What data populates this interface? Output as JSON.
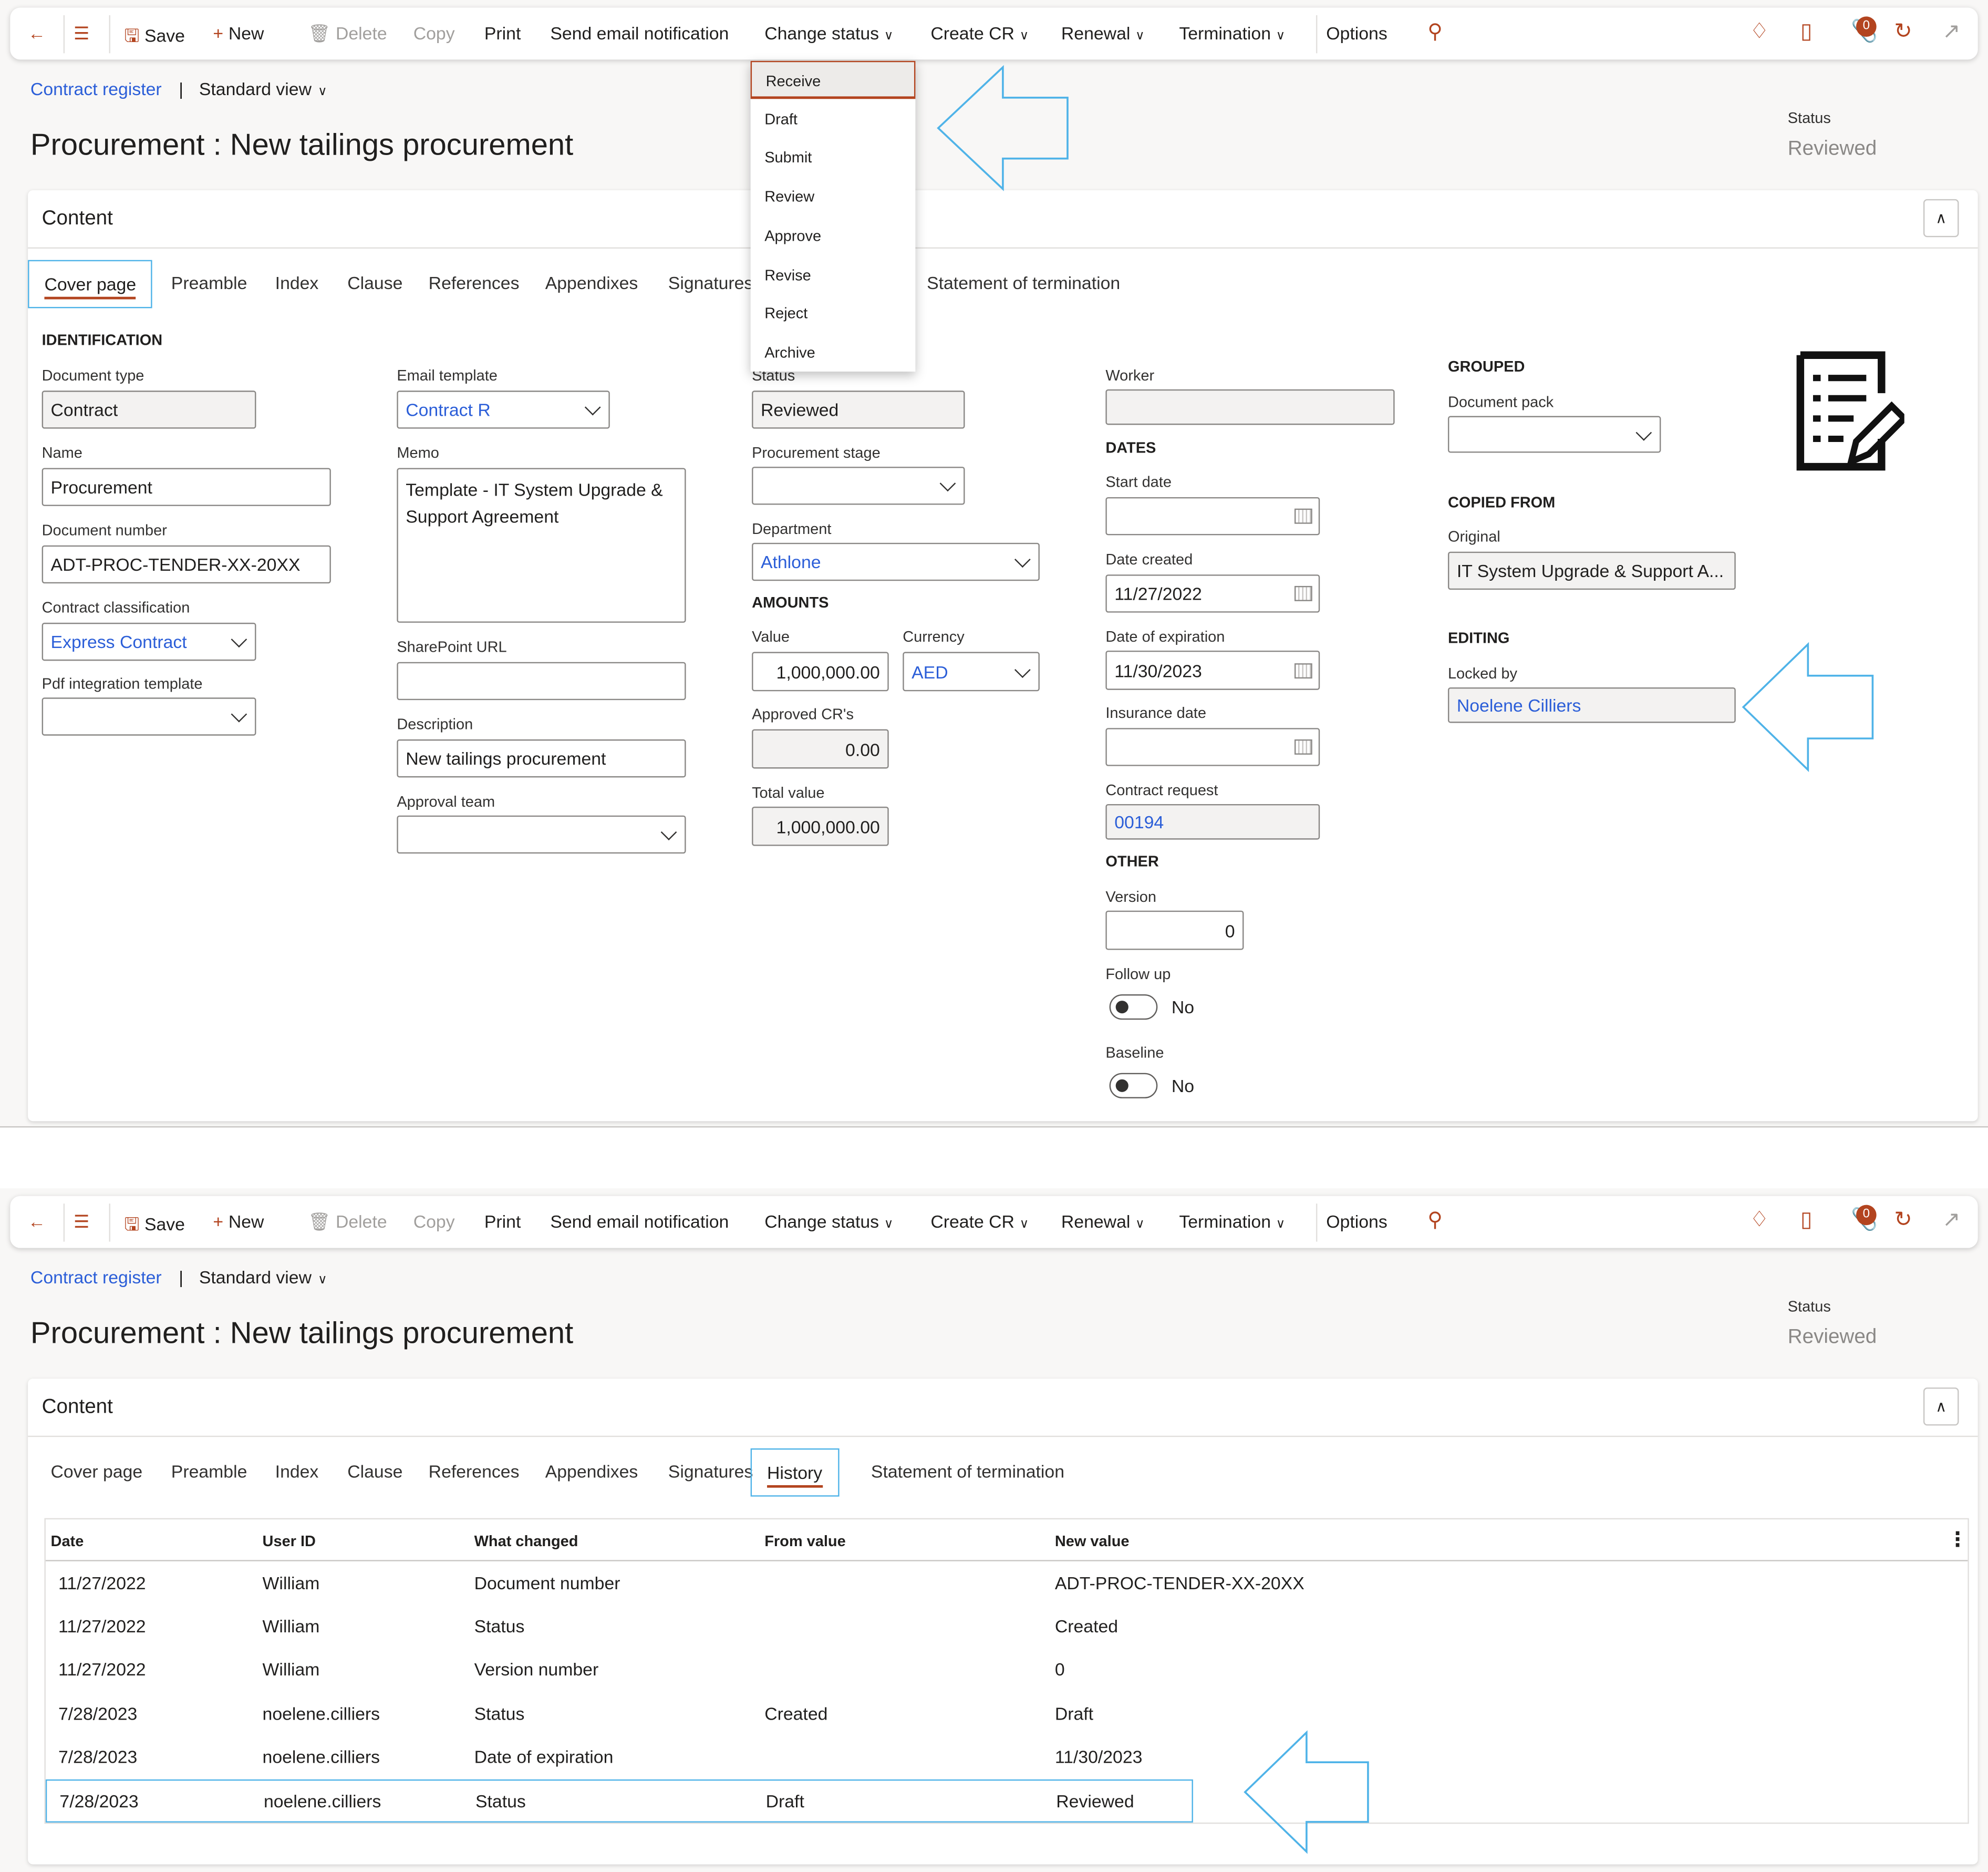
{
  "toolbar": {
    "save": "Save",
    "new": "New",
    "delete": "Delete",
    "copy": "Copy",
    "print": "Print",
    "send_email": "Send email notification",
    "change_status": "Change status",
    "create_cr": "Create CR",
    "renewal": "Renewal",
    "termination": "Termination",
    "options": "Options",
    "attachments_count": "0",
    "icons": [
      "back-arrow-icon",
      "hamburger-icon",
      "save-icon",
      "plus-icon",
      "trash-icon",
      "search-icon",
      "diamond-icon",
      "office-icon",
      "paperclip-icon",
      "refresh-icon",
      "popout-icon"
    ]
  },
  "breadcrumb": {
    "link": "Contract register",
    "separator": "|",
    "view": "Standard view"
  },
  "header": {
    "title": "Procurement : New tailings procurement",
    "status_label": "Status",
    "status_value": "Reviewed"
  },
  "content": {
    "title": "Content"
  },
  "tabs": [
    "Cover page",
    "Preamble",
    "Index",
    "Clause",
    "References",
    "Appendixes",
    "Signatures",
    "History",
    "Statement of termination"
  ],
  "status_menu": [
    "Receive",
    "Draft",
    "Submit",
    "Review",
    "Approve",
    "Revise",
    "Reject",
    "Archive"
  ],
  "cover": {
    "sections": {
      "identification": "IDENTIFICATION",
      "amounts": "AMOUNTS",
      "dates": "DATES",
      "other": "OTHER",
      "grouped": "GROUPED",
      "copied_from": "COPIED FROM",
      "editing": "EDITING"
    },
    "fields": {
      "document_type": {
        "label": "Document type",
        "value": "Contract"
      },
      "name": {
        "label": "Name",
        "value": "Procurement"
      },
      "document_number": {
        "label": "Document number",
        "value": "ADT-PROC-TENDER-XX-20XX"
      },
      "contract_classification": {
        "label": "Contract classification",
        "value": "Express Contract"
      },
      "pdf_template": {
        "label": "Pdf integration template",
        "value": ""
      },
      "email_template": {
        "label": "Email template",
        "value": "Contract R"
      },
      "memo": {
        "label": "Memo",
        "value": "Template - IT System Upgrade & Support Agreement"
      },
      "sharepoint_url": {
        "label": "SharePoint URL",
        "value": ""
      },
      "description": {
        "label": "Description",
        "value": "New tailings procurement"
      },
      "approval_team": {
        "label": "Approval team",
        "value": ""
      },
      "status": {
        "label": "Status",
        "value": "Reviewed"
      },
      "procurement_stage": {
        "label": "Procurement stage",
        "value": ""
      },
      "department": {
        "label": "Department",
        "value": "Athlone"
      },
      "value": {
        "label": "Value",
        "value": "1,000,000.00"
      },
      "currency": {
        "label": "Currency",
        "value": "AED"
      },
      "approved_crs": {
        "label": "Approved CR's",
        "value": "0.00"
      },
      "total_value": {
        "label": "Total value",
        "value": "1,000,000.00"
      },
      "worker": {
        "label": "Worker",
        "value": ""
      },
      "start_date": {
        "label": "Start date",
        "value": ""
      },
      "date_created": {
        "label": "Date created",
        "value": "11/27/2022"
      },
      "date_expiration": {
        "label": "Date of expiration",
        "value": "11/30/2023"
      },
      "insurance_date": {
        "label": "Insurance date",
        "value": ""
      },
      "contract_request": {
        "label": "Contract request",
        "value": "00194"
      },
      "version": {
        "label": "Version",
        "value": "0"
      },
      "follow_up": {
        "label": "Follow up",
        "value": "No"
      },
      "baseline": {
        "label": "Baseline",
        "value": "No"
      },
      "document_pack": {
        "label": "Document pack",
        "value": ""
      },
      "original": {
        "label": "Original",
        "value": "IT System Upgrade & Support A..."
      },
      "locked_by": {
        "label": "Locked by",
        "value": "Noelene Cilliers"
      }
    }
  },
  "history": {
    "columns": [
      "Date",
      "User ID",
      "What changed",
      "From value",
      "New value"
    ],
    "rows": [
      [
        "11/27/2022",
        "William",
        "Document number",
        "",
        "ADT-PROC-TENDER-XX-20XX"
      ],
      [
        "11/27/2022",
        "William",
        "Status",
        "",
        "Created"
      ],
      [
        "11/27/2022",
        "William",
        "Version number",
        "",
        "0"
      ],
      [
        "7/28/2023",
        "noelene.cilliers",
        "Status",
        "Created",
        "Draft"
      ],
      [
        "7/28/2023",
        "noelene.cilliers",
        "Date of expiration",
        "",
        "11/30/2023"
      ],
      [
        "7/28/2023",
        "noelene.cilliers",
        "Status",
        "Draft",
        "Reviewed"
      ]
    ],
    "selected_row": 5
  },
  "colors": {
    "accent": "#b3441f",
    "link": "#2b5ed8",
    "annotation": "#4fb3e8"
  }
}
